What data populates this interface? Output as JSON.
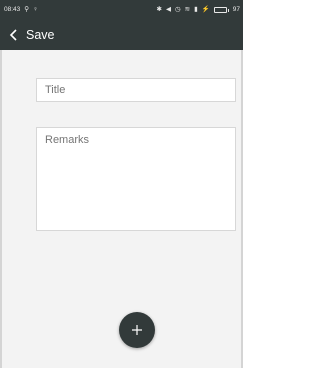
{
  "status_bar": {
    "time": "08:43",
    "icons_left": [
      "usb-icon",
      "person-icon"
    ],
    "icons_right": [
      "bluetooth-icon",
      "mute-icon",
      "alarm-icon",
      "wifi-icon",
      "signal-icon",
      "charging-icon",
      "battery-icon"
    ],
    "battery_text": "97"
  },
  "app_bar": {
    "title": "Save",
    "back_icon": "chevron-left-icon"
  },
  "form": {
    "title_placeholder": "Title",
    "title_value": "",
    "remarks_placeholder": "Remarks",
    "remarks_value": ""
  },
  "fab": {
    "icon": "plus-icon"
  },
  "colors": {
    "bar": "#323a3a",
    "background": "#f3f3f3",
    "field": "#ffffff",
    "border": "#d7d7d7"
  }
}
